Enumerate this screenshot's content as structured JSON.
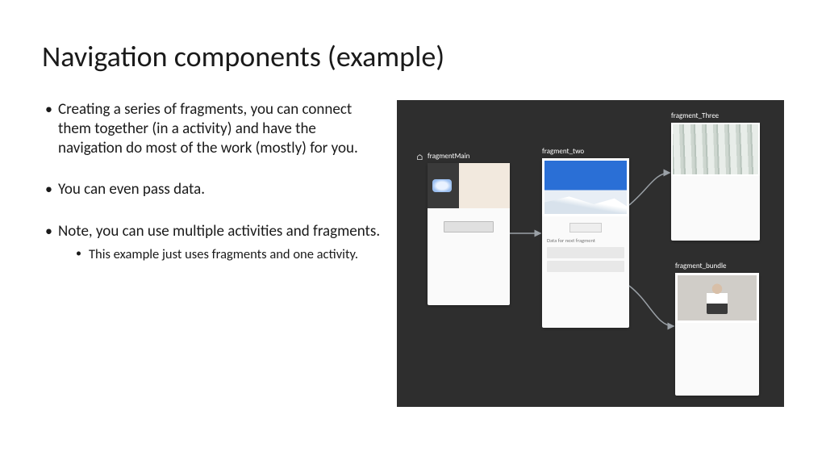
{
  "title": "Navigation components (example)",
  "bullets": {
    "b1": "Creating a series of fragments, you can connect them together (in a activity) and have the navigation do most of the work (mostly) for you.",
    "b2": "You can even pass data.",
    "b3": "Note, you can use multiple activities and fragments.",
    "b3_sub": "This example just uses fragments and one activity."
  },
  "navGraph": {
    "fragments": {
      "main": {
        "label": "fragmentMain",
        "home_icon": "⌂"
      },
      "two": {
        "label": "fragment_two",
        "caption": "Data for next fragment"
      },
      "three": {
        "label": "fragment_Three"
      },
      "bundle": {
        "label": "fragment_bundle"
      }
    }
  }
}
